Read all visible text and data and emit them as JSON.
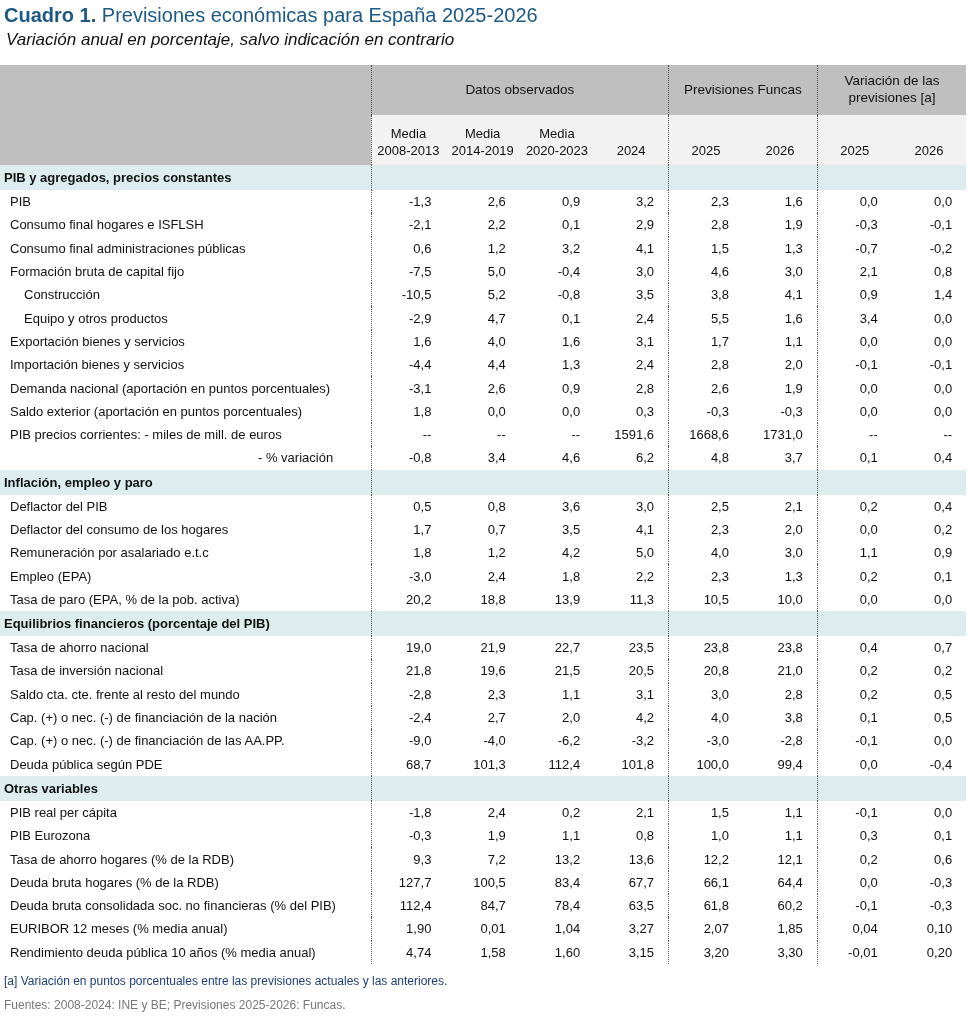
{
  "title": "**Cuadro 1.** Previsiones económicas para España 2025-2026",
  "subtitle": "Variación anual en porcentaje, salvo indicación en contrario",
  "groups": [
    {
      "label": "Datos observados",
      "columns": [
        [
          "Media",
          "2008-2013"
        ],
        [
          "Media",
          "2014-2019"
        ],
        [
          "Media",
          "2020-2023"
        ],
        [
          "2024"
        ]
      ]
    },
    {
      "label": "Previsiones Funcas",
      "columns": [
        [
          "2025"
        ],
        [
          "2026"
        ]
      ]
    },
    {
      "label": "Variación de las previsiones [a]",
      "columns": [
        [
          "2025"
        ],
        [
          "2026"
        ]
      ]
    }
  ],
  "sections": [
    {
      "title": "PIB y agregados, precios constantes",
      "rows": [
        {
          "label": "PIB",
          "values": [
            "-1,3",
            "2,6",
            "0,9",
            "3,2",
            "2,3",
            "1,6",
            "0,0",
            "0,0"
          ]
        },
        {
          "label": "Consumo final hogares e ISFLSH",
          "values": [
            "-2,1",
            "2,2",
            "0,1",
            "2,9",
            "2,8",
            "1,9",
            "-0,3",
            "-0,1"
          ]
        },
        {
          "label": "Consumo final administraciones públicas",
          "values": [
            "0,6",
            "1,2",
            "3,2",
            "4,1",
            "1,5",
            "1,3",
            "-0,7",
            "-0,2"
          ]
        },
        {
          "label": "Formación bruta de capital fijo",
          "values": [
            "-7,5",
            "5,0",
            "-0,4",
            "3,0",
            "4,6",
            "3,0",
            "2,1",
            "0,8"
          ],
          "children": [
            {
              "label": "Construcción",
              "values": [
                "-10,5",
                "5,2",
                "-0,8",
                "3,5",
                "3,8",
                "4,1",
                "0,9",
                "1,4"
              ]
            },
            {
              "label": "Equipo y otros productos",
              "values": [
                "-2,9",
                "4,7",
                "0,1",
                "2,4",
                "5,5",
                "1,6",
                "3,4",
                "0,0"
              ]
            }
          ]
        },
        {
          "label": "Exportación bienes y servicios",
          "values": [
            "1,6",
            "4,0",
            "1,6",
            "3,1",
            "1,7",
            "1,1",
            "0,0",
            "0,0"
          ]
        },
        {
          "label": "Importación bienes y servicios",
          "values": [
            "-4,4",
            "4,4",
            "1,3",
            "2,4",
            "2,8",
            "2,0",
            "-0,1",
            "-0,1"
          ]
        },
        {
          "label": "Demanda nacional (aportación en puntos porcentuales)",
          "values": [
            "-3,1",
            "2,6",
            "0,9",
            "2,8",
            "2,6",
            "1,9",
            "0,0",
            "0,0"
          ]
        },
        {
          "label": "Saldo exterior (aportación en puntos porcentuales)",
          "values": [
            "1,8",
            "0,0",
            "0,0",
            "0,3",
            "-0,3",
            "-0,3",
            "0,0",
            "0,0"
          ]
        },
        {
          "label": "PIB precios corrientes: - miles de mill. de euros",
          "values": [
            "--",
            "--",
            "--",
            "1591,6",
            "1668,6",
            "1731,0",
            "--",
            "--"
          ]
        },
        {
          "label": "- % variación",
          "kind": "continuation",
          "values": [
            "-0,8",
            "3,4",
            "4,6",
            "6,2",
            "4,8",
            "3,7",
            "0,1",
            "0,4"
          ]
        }
      ]
    },
    {
      "title": "Inflación, empleo y paro",
      "rows": [
        {
          "label": "Deflactor del PIB",
          "values": [
            "0,5",
            "0,8",
            "3,6",
            "3,0",
            "2,5",
            "2,1",
            "0,2",
            "0,4"
          ]
        },
        {
          "label": "Deflactor del consumo de los hogares",
          "values": [
            "1,7",
            "0,7",
            "3,5",
            "4,1",
            "2,3",
            "2,0",
            "0,0",
            "0,2"
          ]
        },
        {
          "label": "Remuneración por asalariado e.t.c",
          "values": [
            "1,8",
            "1,2",
            "4,2",
            "5,0",
            "4,0",
            "3,0",
            "1,1",
            "0,9"
          ]
        },
        {
          "label": "Empleo (EPA)",
          "values": [
            "-3,0",
            "2,4",
            "1,8",
            "2,2",
            "2,3",
            "1,3",
            "0,2",
            "0,1"
          ]
        },
        {
          "label": "Tasa de paro (EPA, % de la pob. activa)",
          "values": [
            "20,2",
            "18,8",
            "13,9",
            "11,3",
            "10,5",
            "10,0",
            "0,0",
            "0,0"
          ]
        }
      ]
    },
    {
      "title": "Equilibrios financieros (porcentaje del PIB)",
      "rows": [
        {
          "label": "Tasa de ahorro nacional",
          "values": [
            "19,0",
            "21,9",
            "22,7",
            "23,5",
            "23,8",
            "23,8",
            "0,4",
            "0,7"
          ]
        },
        {
          "label": "Tasa de inversión nacional",
          "values": [
            "21,8",
            "19,6",
            "21,5",
            "20,5",
            "20,8",
            "21,0",
            "0,2",
            "0,2"
          ]
        },
        {
          "label": "Saldo cta. cte. frente al resto del mundo",
          "values": [
            "-2,8",
            "2,3",
            "1,1",
            "3,1",
            "3,0",
            "2,8",
            "0,2",
            "0,5"
          ]
        },
        {
          "label": "Cap. (+) o nec. (-) de financiación de la nación",
          "values": [
            "-2,4",
            "2,7",
            "2,0",
            "4,2",
            "4,0",
            "3,8",
            "0,1",
            "0,5"
          ]
        },
        {
          "label": "Cap. (+) o nec. (-) de financiación de las AA.PP.",
          "values": [
            "-9,0",
            "-4,0",
            "-6,2",
            "-3,2",
            "-3,0",
            "-2,8",
            "-0,1",
            "0,0"
          ]
        },
        {
          "label": "Deuda pública según PDE",
          "values": [
            "68,7",
            "101,3",
            "112,4",
            "101,8",
            "100,0",
            "99,4",
            "0,0",
            "-0,4"
          ]
        }
      ]
    },
    {
      "title": "Otras variables",
      "rows": [
        {
          "label": "PIB real per cápita",
          "values": [
            "-1,8",
            "2,4",
            "0,2",
            "2,1",
            "1,5",
            "1,1",
            "-0,1",
            "0,0"
          ]
        },
        {
          "label": "PIB Eurozona",
          "values": [
            "-0,3",
            "1,9",
            "1,1",
            "0,8",
            "1,0",
            "1,1",
            "0,3",
            "0,1"
          ]
        },
        {
          "label": "Tasa de ahorro hogares (% de la RDB)",
          "values": [
            "9,3",
            "7,2",
            "13,2",
            "13,6",
            "12,2",
            "12,1",
            "0,2",
            "0,6"
          ]
        },
        {
          "label": "Deuda bruta hogares (% de la RDB)",
          "values": [
            "127,7",
            "100,5",
            "83,4",
            "67,7",
            "66,1",
            "64,4",
            "0,0",
            "-0,3"
          ]
        },
        {
          "label": "Deuda bruta consolidada soc. no financieras (% del PIB)",
          "values": [
            "112,4",
            "84,7",
            "78,4",
            "63,5",
            "61,8",
            "60,2",
            "-0,1",
            "-0,3"
          ]
        },
        {
          "label": "EURIBOR 12 meses (% media anual)",
          "values": [
            "1,90",
            "0,01",
            "1,04",
            "3,27",
            "2,07",
            "1,85",
            "0,04",
            "0,10"
          ]
        },
        {
          "label": "Rendimiento deuda pública 10 años (% media anual)",
          "values": [
            "4,74",
            "1,58",
            "1,60",
            "3,15",
            "3,20",
            "3,30",
            "-0,01",
            "0,20"
          ]
        }
      ]
    }
  ],
  "note": "[a] Variación en puntos porcentuales entre las previsiones actuales y las anteriores.",
  "source": "Fuentes: 2008-2024: INE y BE; Previsiones 2025-2026: Funcas."
}
